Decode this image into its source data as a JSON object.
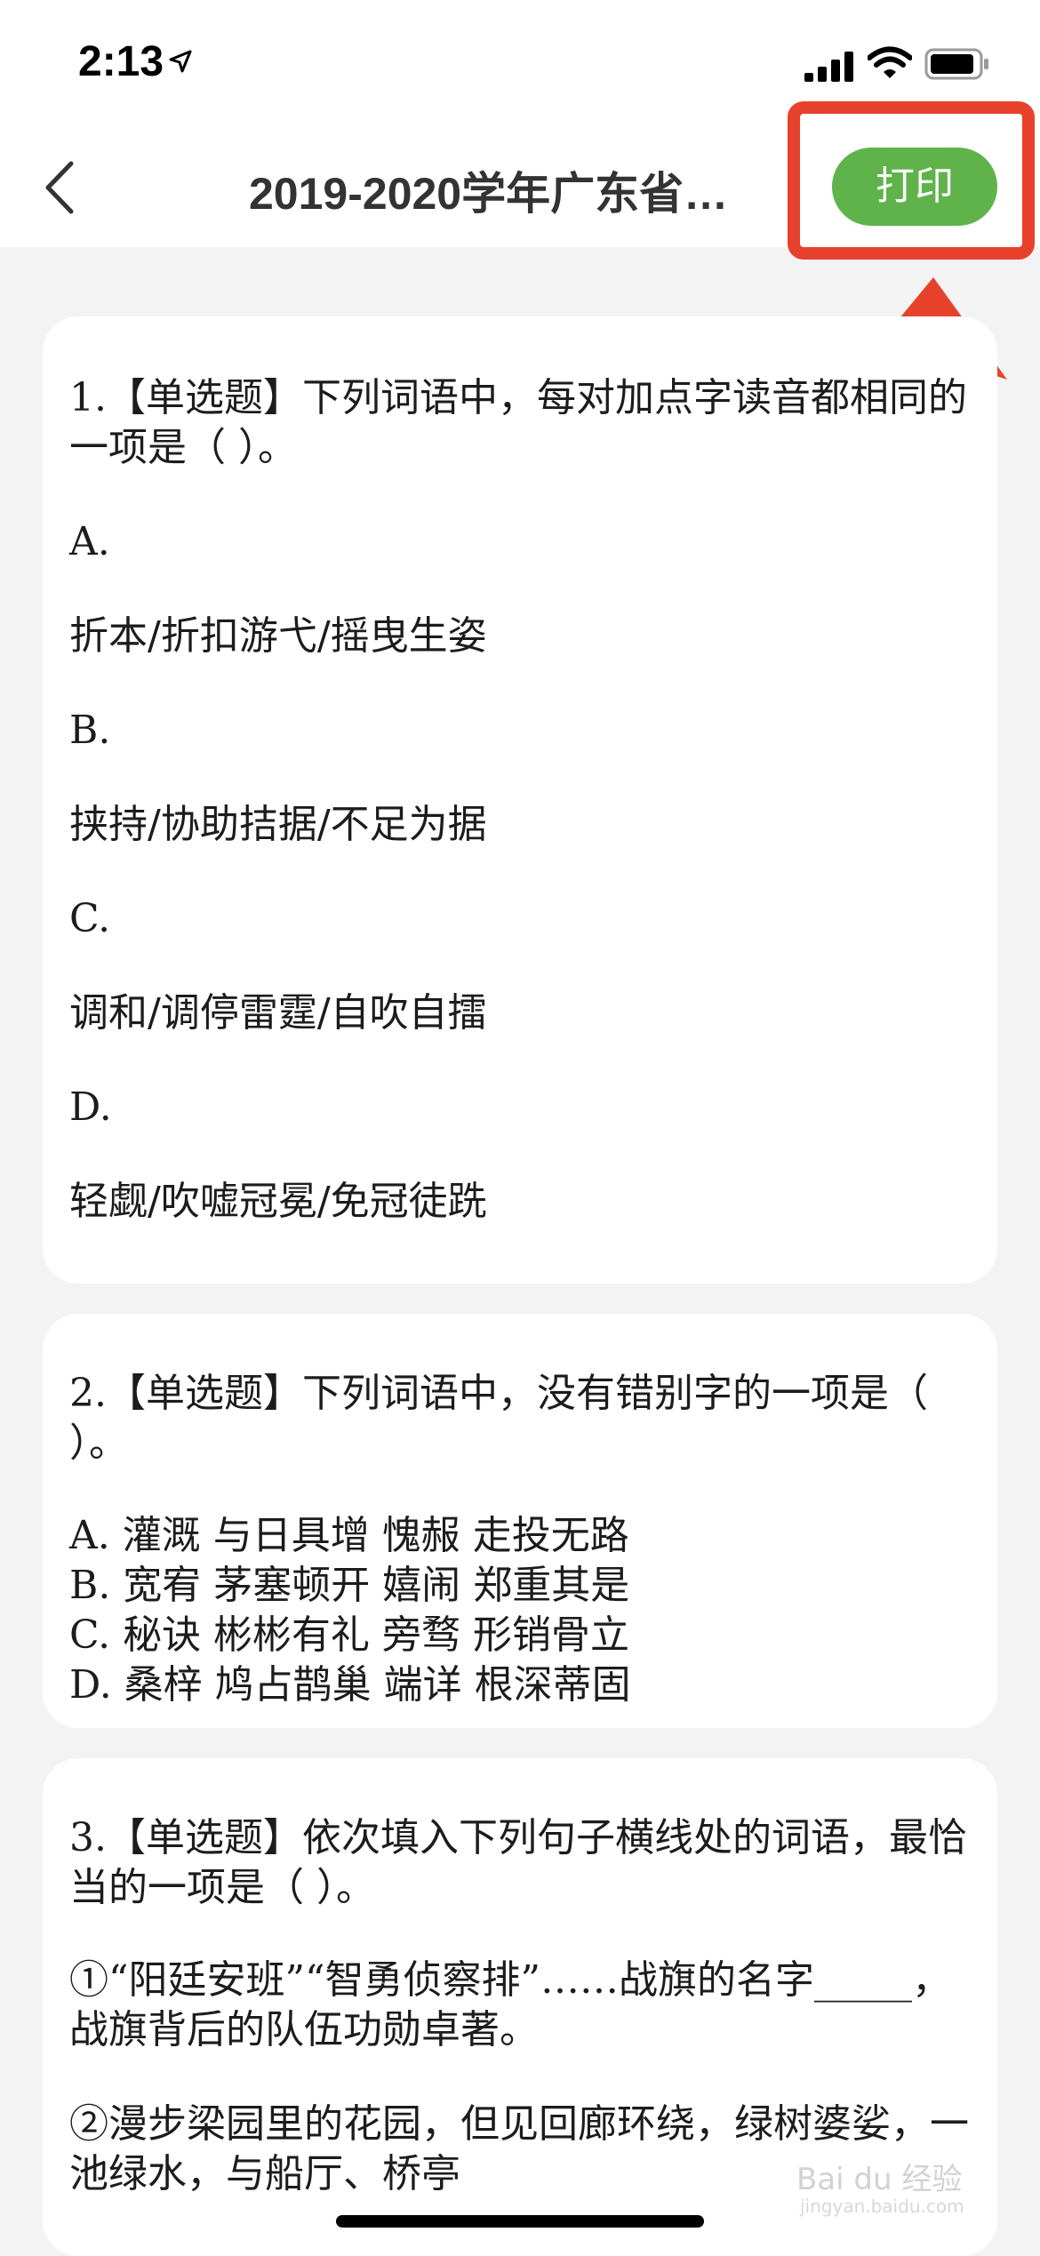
{
  "status_bar": {
    "time": "2:13",
    "icons": [
      "location-arrow-icon",
      "signal-icon",
      "wifi-icon",
      "battery-icon"
    ]
  },
  "nav": {
    "title": "2019-2020学年广东省…",
    "print_label": "打印",
    "back_icon": "chevron-left-icon"
  },
  "colors": {
    "accent": "#5fb34a",
    "highlight": "#e8412c",
    "background": "#f3f3f3"
  },
  "questions": [
    {
      "stem": "1.【单选题】下列词语中，每对加点字读音都相同的一项是（ ）。",
      "options": [
        {
          "label": "A.",
          "text": "折本/折扣游弋/摇曳生姿"
        },
        {
          "label": "B.",
          "text": "挟持/协助拮据/不足为据"
        },
        {
          "label": "C.",
          "text": "调和/调停雷霆/自吹自擂"
        },
        {
          "label": "D.",
          "text": "轻觑/吹嘘冠冕/免冠徒跣"
        }
      ]
    },
    {
      "stem": "2.【单选题】下列词语中，没有错别字的一项是（ ）。",
      "options": [
        "A. 灌溉 与日具增 愧赧 走投无路",
        "B. 宽宥 茅塞顿开 嬉闹 郑重其是",
        "C. 秘诀 彬彬有礼 旁骛 形销骨立",
        "D. 桑梓 鸠占鹊巢 端详 根深蒂固"
      ]
    },
    {
      "stem": "3.【单选题】依次填入下列句子横线处的词语，最恰当的一项是（ ）。",
      "lines": [
        "①“阳廷安班”“智勇侦察排”……战旗的名字_____，战旗背后的队伍功勋卓著。",
        "②漫步梁园里的花园，但见回廊环绕，绿树婆娑，一池绿水，与船厅、桥亭"
      ]
    }
  ],
  "watermark": {
    "text": "Bai du 经验",
    "sub": "jingyan.baidu.com"
  }
}
